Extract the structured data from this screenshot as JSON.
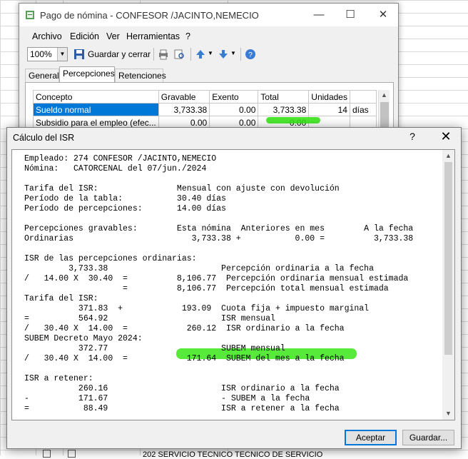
{
  "back_window": {
    "title": "Pago de nómina - CONFESOR /JACINTO,NEMECIO",
    "controls": {
      "minimize": "—",
      "maximize": "☐",
      "close": "✕"
    },
    "menu": [
      "Archivo",
      "Edición",
      "Ver",
      "Herramientas",
      "?"
    ],
    "toolbar": {
      "zoom": "100%",
      "save_close": "Guardar y cerrar"
    },
    "tabs": [
      "General",
      "Percepciones",
      "Retenciones"
    ],
    "active_tab": "Percepciones",
    "grid": {
      "headers": [
        "Concepto",
        "Gravable",
        "Exento",
        "Total",
        "Unidades"
      ],
      "rows": [
        [
          "Sueldo normal",
          "3,733.38",
          "0.00",
          "3,733.38",
          "14",
          "días"
        ],
        [
          "Subsidio para el empleo (efec...",
          "0.00",
          "0.00",
          "0.00",
          "",
          ""
        ]
      ]
    }
  },
  "dialog": {
    "title": "Cálculo del ISR",
    "help": "?",
    "close": "✕",
    "report_lines": [
      "Empleado: 274 CONFESOR /JACINTO,NEMECIO",
      "Nómina:   CATORCENAL del 07/jun./2024",
      "",
      "Tarifa del ISR:                Mensual con ajuste con devolución",
      "Período de la tabla:           30.40 días",
      "Período de percepciones:       14.00 días",
      "",
      "Percepciones gravables:        Esta nómina  Anteriores en mes        A la fecha",
      "Ordinarias                        3,733.38 +           0.00 =          3,733.38",
      "",
      "ISR de las percepciones ordinarias:",
      "         3,733.38                       Percepción ordinaria a la fecha",
      "/   14.00 X  30.40  =          8,106.77  Percepción ordinaria mensual estimada",
      "                    =          8,106.77  Percepción total mensual estimada",
      "Tarifa del ISR:",
      "           371.83  +            193.09  Cuota fija + impuesto marginal",
      "=          564.92                       ISR mensual",
      "/   30.40 X  14.00  =            260.12  ISR ordinario a la fecha",
      "SUBEM Decreto Mayo 2024:",
      "           372.77                       SUBEM mensual",
      "/   30.40 X  14.00  =            171.64  SUBEM del mes a la fecha",
      "",
      "ISR a retener:",
      "           260.16                       ISR ordinario a la fecha",
      "-          171.67                       - SUBEM a la fecha",
      "=           88.49                       ISR a retener a la fecha"
    ],
    "buttons": {
      "accept": "Aceptar",
      "save": "Guardar..."
    }
  },
  "background_sheet": {
    "row_text": "202 SERVICIO TECNICO  TECNICO DE SERVICIO"
  },
  "colors": {
    "highlight": "#39e619",
    "selection": "#0078d7"
  }
}
